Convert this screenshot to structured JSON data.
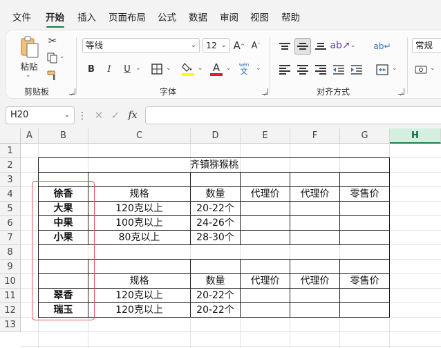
{
  "menu": {
    "items": [
      {
        "key": "file",
        "label": "文件"
      },
      {
        "key": "home",
        "label": "开始"
      },
      {
        "key": "insert",
        "label": "插入"
      },
      {
        "key": "layout",
        "label": "页面布局"
      },
      {
        "key": "formulas",
        "label": "公式"
      },
      {
        "key": "data",
        "label": "数据"
      },
      {
        "key": "review",
        "label": "审阅"
      },
      {
        "key": "view",
        "label": "视图"
      },
      {
        "key": "help",
        "label": "帮助"
      }
    ],
    "active": "开始"
  },
  "ribbon": {
    "clipboard": {
      "label": "剪贴板",
      "paste_label": "粘贴"
    },
    "font": {
      "label": "字体",
      "font_name": "等线",
      "font_size": "12",
      "grow": "A",
      "shrink": "A",
      "bold": "B",
      "italic": "I",
      "underline": "U",
      "font_color_letter": "A",
      "phonetic_top": "wén",
      "phonetic_bottom": "文",
      "highlight_color": "#ffff00",
      "font_color": "#e02020"
    },
    "alignment": {
      "label": "对齐方式"
    },
    "number": {
      "format": "常规"
    }
  },
  "formula_bar": {
    "name_box": "H20",
    "fx": "fx",
    "value": ""
  },
  "sheet": {
    "columns": [
      "A",
      "B",
      "C",
      "D",
      "E",
      "F",
      "G",
      "H"
    ],
    "selected_column": "H",
    "rows": [
      "1",
      "2",
      "3",
      "4",
      "5",
      "6",
      "7",
      "8",
      "9",
      "10",
      "11",
      "12",
      "13"
    ],
    "title": "齐镇猕猴桃",
    "header_row_4": [
      "徐香",
      "规格",
      "数量",
      "代理价",
      "代理价",
      "零售价"
    ],
    "header_row_10": [
      "规格",
      "数量",
      "代理价",
      "代理价",
      "零售价"
    ],
    "rows_data": [
      {
        "row": "5",
        "name": "大果",
        "spec": "120克以上",
        "qty": "20-22个"
      },
      {
        "row": "6",
        "name": "中果",
        "spec": "100克以上",
        "qty": "24-26个"
      },
      {
        "row": "7",
        "name": "小果",
        "spec": "80克以上",
        "qty": "28-30个"
      },
      {
        "row": "11",
        "name": "翠香",
        "spec": "120克以上",
        "qty": "20-22个"
      },
      {
        "row": "12",
        "name": "瑞玉",
        "spec": "120克以上",
        "qty": "20-22个"
      }
    ],
    "highlight_color": "#e0525a",
    "selection_color": "#1a7c47"
  }
}
